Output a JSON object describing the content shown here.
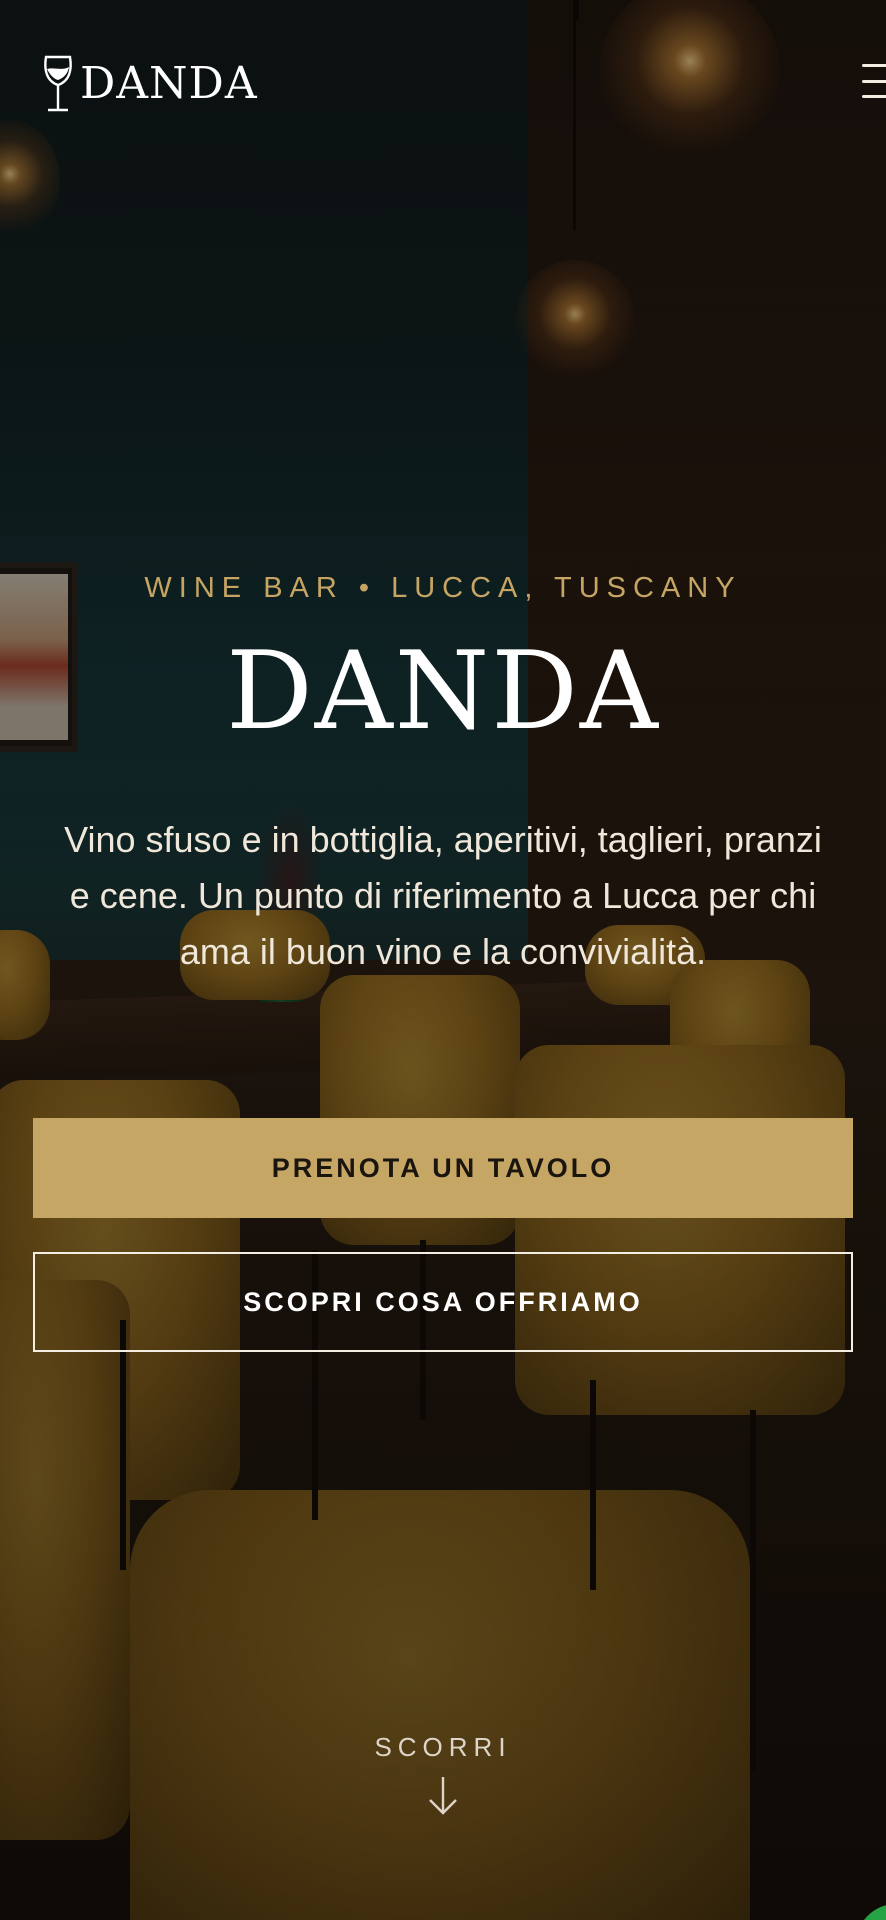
{
  "header": {
    "logo_text": "DANDA",
    "menu_icon": "hamburger-menu-icon"
  },
  "hero": {
    "eyebrow": "WINE BAR • LUCCA, TUSCANY",
    "title": "DANDA",
    "description": "Vino sfuso e in bottiglia, aperitivi, taglieri, pranzi e cene. Un punto di riferimento a Lucca per chi ama il buon vino e la convivialità.",
    "primary_cta": "PRENOTA UN TAVOLO",
    "secondary_cta": "SCOPRI COSA OFFRIAMO",
    "scroll_label": "SCORRI",
    "scroll_icon": "arrow-down-icon"
  },
  "floating": {
    "chat_icon": "chat-bubble-icon"
  },
  "colors": {
    "accent": "#c6a664",
    "eyebrow": "#c6a564",
    "text": "#efe7da",
    "chat": "#25a244"
  }
}
